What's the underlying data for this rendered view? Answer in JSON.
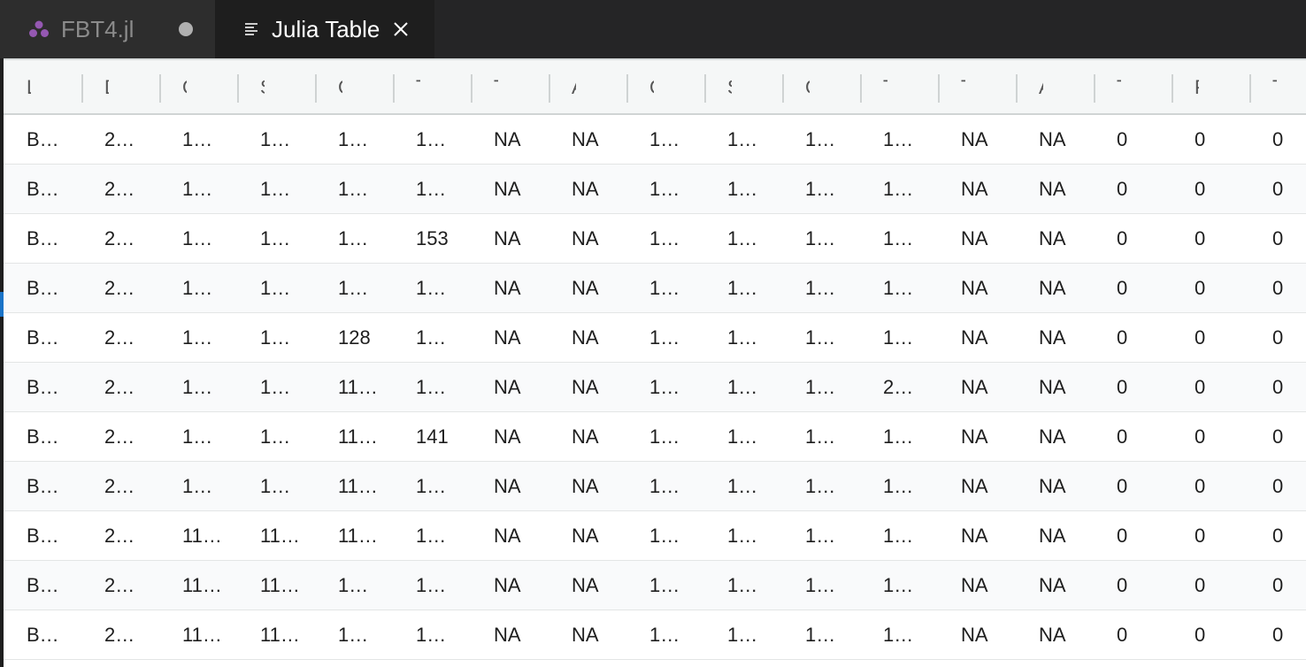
{
  "tabs": [
    {
      "label": "FBT4.jl",
      "icon": "julia-icon",
      "active": false,
      "dirty": true
    },
    {
      "label": "Julia Table",
      "icon": "preview-icon",
      "active": true
    }
  ],
  "table": {
    "header_glyphs": [
      "L",
      "D",
      "C",
      "S",
      "C",
      "T",
      "T",
      "A",
      "C",
      "S",
      "C",
      "T",
      "T",
      "A",
      "T",
      "P",
      "T"
    ],
    "rows": [
      [
        "B…",
        "2…",
        "1…",
        "1…",
        "1…",
        "1…",
        "NA",
        "NA",
        "1…",
        "1…",
        "1…",
        "1…",
        "NA",
        "NA",
        "0",
        "0",
        "0"
      ],
      [
        "B…",
        "2…",
        "1…",
        "1…",
        "1…",
        "1…",
        "NA",
        "NA",
        "1…",
        "1…",
        "1…",
        "1…",
        "NA",
        "NA",
        "0",
        "0",
        "0"
      ],
      [
        "B…",
        "2…",
        "1…",
        "1…",
        "1…",
        "153",
        "NA",
        "NA",
        "1…",
        "1…",
        "1…",
        "1…",
        "NA",
        "NA",
        "0",
        "0",
        "0"
      ],
      [
        "B…",
        "2…",
        "1…",
        "1…",
        "1…",
        "1…",
        "NA",
        "NA",
        "1…",
        "1…",
        "1…",
        "1…",
        "NA",
        "NA",
        "0",
        "0",
        "0"
      ],
      [
        "B…",
        "2…",
        "1…",
        "1…",
        "128",
        "1…",
        "NA",
        "NA",
        "1…",
        "1…",
        "1…",
        "1…",
        "NA",
        "NA",
        "0",
        "0",
        "0"
      ],
      [
        "B…",
        "2…",
        "1…",
        "1…",
        "11…",
        "1…",
        "NA",
        "NA",
        "1…",
        "1…",
        "1…",
        "2…",
        "NA",
        "NA",
        "0",
        "0",
        "0"
      ],
      [
        "B…",
        "2…",
        "1…",
        "1…",
        "11…",
        "141",
        "NA",
        "NA",
        "1…",
        "1…",
        "1…",
        "1…",
        "NA",
        "NA",
        "0",
        "0",
        "0"
      ],
      [
        "B…",
        "2…",
        "1…",
        "1…",
        "11…",
        "1…",
        "NA",
        "NA",
        "1…",
        "1…",
        "1…",
        "1…",
        "NA",
        "NA",
        "0",
        "0",
        "0"
      ],
      [
        "B…",
        "2…",
        "11…",
        "11…",
        "11…",
        "1…",
        "NA",
        "NA",
        "1…",
        "1…",
        "1…",
        "1…",
        "NA",
        "NA",
        "0",
        "0",
        "0"
      ],
      [
        "B…",
        "2…",
        "11…",
        "11…",
        "1…",
        "1…",
        "NA",
        "NA",
        "1…",
        "1…",
        "1…",
        "1…",
        "NA",
        "NA",
        "0",
        "0",
        "0"
      ],
      [
        "B…",
        "2…",
        "11…",
        "11…",
        "1…",
        "1…",
        "NA",
        "NA",
        "1…",
        "1…",
        "1…",
        "1…",
        "NA",
        "NA",
        "0",
        "0",
        "0"
      ]
    ]
  },
  "colors": {
    "tabbar_bg": "#252526",
    "active_tab_bg": "#1e1e1e",
    "julia_purple": "#9558b2",
    "header_bg": "#f5f7f7",
    "row_alt_bg": "#f9fafb"
  }
}
